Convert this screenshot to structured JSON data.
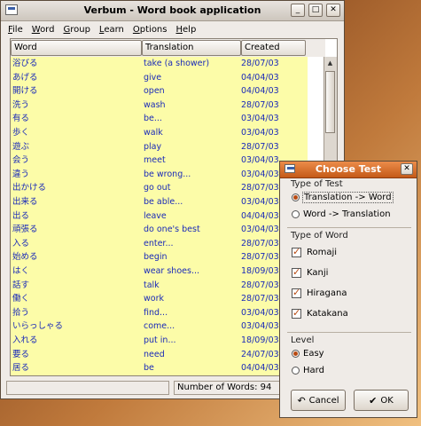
{
  "window": {
    "title": "Verbum - Word book application",
    "minimize": "_",
    "maximize": "□",
    "close": "✕"
  },
  "menu": [
    {
      "pre": "",
      "u": "F",
      "post": "ile"
    },
    {
      "pre": "",
      "u": "W",
      "post": "ord"
    },
    {
      "pre": "",
      "u": "G",
      "post": "roup"
    },
    {
      "pre": "",
      "u": "L",
      "post": "earn"
    },
    {
      "pre": "",
      "u": "O",
      "post": "ptions"
    },
    {
      "pre": "",
      "u": "H",
      "post": "elp"
    }
  ],
  "columns": {
    "word": "Word",
    "translation": "Translation",
    "created": "Created"
  },
  "rows": [
    [
      "浴びる",
      "take (a shower)",
      "28/07/03"
    ],
    [
      "あげる",
      "give",
      "04/04/03"
    ],
    [
      "開ける",
      "open",
      "04/04/03"
    ],
    [
      "洗う",
      "wash",
      "28/07/03"
    ],
    [
      "有る",
      "be...",
      "03/04/03"
    ],
    [
      "歩く",
      "walk",
      "03/04/03"
    ],
    [
      "遊ぶ",
      "play",
      "28/07/03"
    ],
    [
      "会う",
      "meet",
      "03/04/03"
    ],
    [
      "違う",
      "be wrong...",
      "03/04/03"
    ],
    [
      "出かける",
      "go out",
      "28/07/03"
    ],
    [
      "出来る",
      "be able...",
      "03/04/03"
    ],
    [
      "出る",
      "leave",
      "04/04/03"
    ],
    [
      "頑張る",
      "do one's best",
      "03/04/03"
    ],
    [
      "入る",
      "enter...",
      "28/07/03"
    ],
    [
      "始める",
      "begin",
      "28/07/03"
    ],
    [
      "はく",
      "wear shoes...",
      "18/09/03"
    ],
    [
      "話す",
      "talk",
      "28/07/03"
    ],
    [
      "働く",
      "work",
      "28/07/03"
    ],
    [
      "拾う",
      "find...",
      "03/04/03"
    ],
    [
      "いらっしゃる",
      "come...",
      "03/04/03"
    ],
    [
      "入れる",
      "put in...",
      "18/09/03"
    ],
    [
      "要る",
      "need",
      "24/07/03"
    ],
    [
      "居る",
      "be",
      "04/04/03"
    ]
  ],
  "status": {
    "left": "",
    "count": "Number of Words: 94"
  },
  "dialog": {
    "title": "Choose Test",
    "close": "✕",
    "test_type_label": "Type of Test",
    "test_types": [
      {
        "label": "Translation -> Word",
        "selected": true
      },
      {
        "label": "Word -> Translation",
        "selected": false
      }
    ],
    "word_type_label": "Type of Word",
    "word_types": [
      {
        "label": "Romaji",
        "checked": true
      },
      {
        "label": "Kanji",
        "checked": true
      },
      {
        "label": "Hiragana",
        "checked": true
      },
      {
        "label": "Katakana",
        "checked": true
      }
    ],
    "level_label": "Level",
    "levels": [
      {
        "label": "Easy",
        "selected": true
      },
      {
        "label": "Hard",
        "selected": false
      }
    ],
    "cancel_label": "Cancel",
    "ok_label": "OK"
  }
}
